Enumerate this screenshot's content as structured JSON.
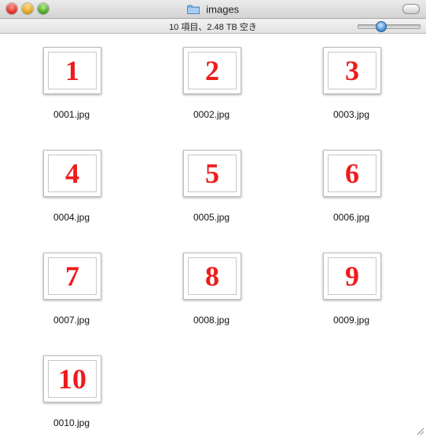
{
  "window": {
    "title": "images",
    "folder_icon": "folder-icon"
  },
  "statusbar": {
    "text": "10 項目、2.48 TB 空き",
    "icon_size_slider": 0.35
  },
  "files": [
    {
      "name": "0001.jpg",
      "thumb_label": "1"
    },
    {
      "name": "0002.jpg",
      "thumb_label": "2"
    },
    {
      "name": "0003.jpg",
      "thumb_label": "3"
    },
    {
      "name": "0004.jpg",
      "thumb_label": "4"
    },
    {
      "name": "0005.jpg",
      "thumb_label": "5"
    },
    {
      "name": "0006.jpg",
      "thumb_label": "6"
    },
    {
      "name": "0007.jpg",
      "thumb_label": "7"
    },
    {
      "name": "0008.jpg",
      "thumb_label": "8"
    },
    {
      "name": "0009.jpg",
      "thumb_label": "9"
    },
    {
      "name": "0010.jpg",
      "thumb_label": "10"
    }
  ],
  "colors": {
    "thumb_number": "#ee1c1c"
  }
}
